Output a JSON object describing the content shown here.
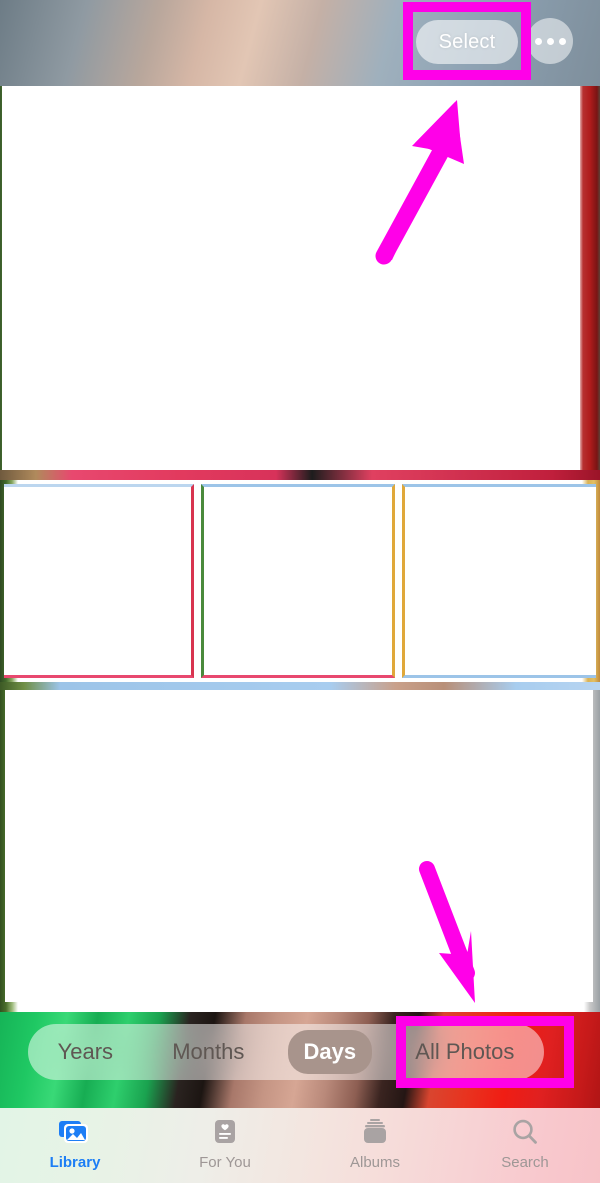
{
  "app": {
    "name": "Photos",
    "platform": "iOS"
  },
  "header": {
    "title": "",
    "select_label": "Select",
    "more_icon": "ellipsis-icon"
  },
  "segmented_control": {
    "options": [
      {
        "label": "Years",
        "selected": false,
        "highlighted": false
      },
      {
        "label": "Months",
        "selected": false,
        "highlighted": false
      },
      {
        "label": "Days",
        "selected": true,
        "highlighted": false
      },
      {
        "label": "All Photos",
        "selected": false,
        "highlighted": true
      }
    ]
  },
  "grid": {
    "hero_photo": {
      "name": "hero-photo"
    },
    "thumbnails": [
      {
        "name": "thumbnail-1"
      },
      {
        "name": "thumbnail-2"
      },
      {
        "name": "thumbnail-3"
      }
    ],
    "lower_photo": {
      "name": "lower-photo"
    }
  },
  "tabbar": {
    "items": [
      {
        "label": "Library",
        "icon": "photo-stack-icon",
        "active": true
      },
      {
        "label": "For You",
        "icon": "for-you-card-icon",
        "active": false
      },
      {
        "label": "Albums",
        "icon": "albums-stack-icon",
        "active": false
      },
      {
        "label": "Search",
        "icon": "search-icon",
        "active": false
      }
    ]
  },
  "annotations": {
    "color": "#ff00e8",
    "highlight_boxes": [
      {
        "target": "Select",
        "name": "highlight-box-select"
      },
      {
        "target": "All Photos",
        "name": "highlight-box-all-photos"
      }
    ],
    "arrows": [
      {
        "name": "arrow-to-select",
        "direction": "up-right"
      },
      {
        "name": "arrow-to-all-photos",
        "direction": "down-right"
      }
    ]
  }
}
